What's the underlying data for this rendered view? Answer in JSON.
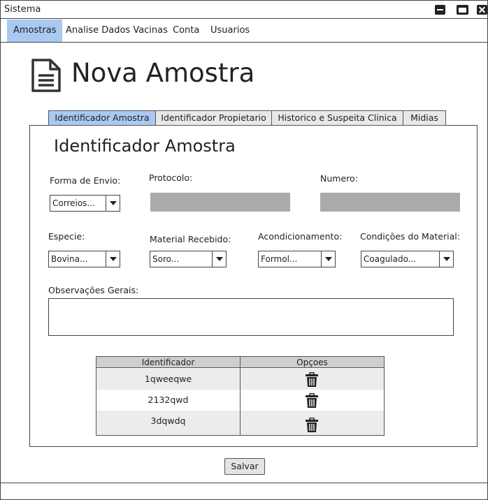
{
  "window": {
    "title": "Sistema"
  },
  "menu": [
    {
      "label": "Amostras",
      "active": true
    },
    {
      "label": "Analise Dados Vacinas",
      "active": false
    },
    {
      "label": "Conta",
      "active": false
    },
    {
      "label": "Usuarios",
      "active": false
    }
  ],
  "page": {
    "title": "Nova Amostra"
  },
  "tabs": [
    {
      "label": "Identificador Amostra",
      "active": true
    },
    {
      "label": "Identificador Propietario",
      "active": false
    },
    {
      "label": "Historico e Suspeita Clinica",
      "active": false
    },
    {
      "label": "Midias",
      "active": false
    }
  ],
  "form": {
    "section_title": "Identificador Amostra",
    "forma_envio": {
      "label": "Forma de Envio:",
      "value": "Correios..."
    },
    "protocolo": {
      "label": "Protocolo:",
      "value": ""
    },
    "numero": {
      "label": "Numero:",
      "value": ""
    },
    "especie": {
      "label": "Especie:",
      "value": "Bovina..."
    },
    "material": {
      "label": "Material Recebido:",
      "value": "Soro..."
    },
    "acondicionamento": {
      "label": "Acondicionamento:",
      "value": "Formol..."
    },
    "condicoes": {
      "label": "Condições do Material:",
      "value": "Coagulado..."
    },
    "observacoes": {
      "label": "Observações Gerais:",
      "value": ""
    }
  },
  "grid": {
    "headers": [
      "Identificador",
      "Opçoes"
    ],
    "rows": [
      {
        "id": "1qweeqwe",
        "action_icon": "trash-icon"
      },
      {
        "id": "2132qwd",
        "action_icon": "trash-icon"
      },
      {
        "id": "3dqwdq",
        "action_icon": "trash-icon"
      }
    ]
  },
  "buttons": {
    "save": "Salvar"
  },
  "colors": {
    "accent": "#a9c8f2",
    "input_grey": "#aaaaaa",
    "table_header": "#cfcfcf"
  }
}
